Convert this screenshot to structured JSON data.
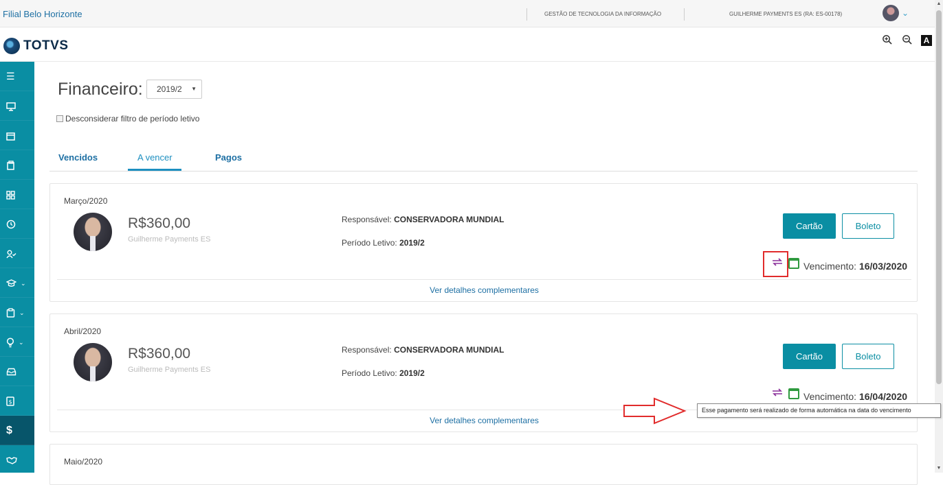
{
  "topbar": {
    "branch": "Filial Belo Horizonte",
    "unit": "GESTÃO DE TECNOLOGIA DA INFORMAÇÃO",
    "user": "GUILHERME PAYMENTS ES (RA: ES-00178)"
  },
  "brand": {
    "name": "TOTVS"
  },
  "page": {
    "title": "Financeiro:",
    "period_value": "2019/2",
    "checkbox_label": "Desconsiderar filtro de período letivo"
  },
  "tabs": [
    {
      "label": "Vencidos",
      "active": false
    },
    {
      "label": "A vencer",
      "active": true
    },
    {
      "label": "Pagos",
      "active": false
    }
  ],
  "cards": [
    {
      "month": "Março/2020",
      "amount": "R$360,00",
      "payer": "Guilherme Payments ES",
      "responsible_label": "Responsável:",
      "responsible": "CONSERVADORA MUNDIAL",
      "period_label": "Período Letivo:",
      "period": "2019/2",
      "pay_card_label": "Cartão",
      "pay_boleto_label": "Boleto",
      "due_label": "Vencimento:",
      "due_date": "16/03/2020",
      "details_link": "Ver detalhes complementares"
    },
    {
      "month": "Abril/2020",
      "amount": "R$360,00",
      "payer": "Guilherme Payments ES",
      "responsible_label": "Responsável:",
      "responsible": "CONSERVADORA MUNDIAL",
      "period_label": "Período Letivo:",
      "period": "2019/2",
      "pay_card_label": "Cartão",
      "pay_boleto_label": "Boleto",
      "due_label": "Vencimento:",
      "due_date": "16/04/2020",
      "details_link": "Ver detalhes complementares"
    },
    {
      "month": "Maio/2020"
    }
  ],
  "tooltip": {
    "text": "Esse pagamento será realizado de forma automática na data do vencimento"
  },
  "colors": {
    "accent": "#0a8ea3",
    "link": "#1d6fa3",
    "auto_icon": "#8a2d9a",
    "calendar_icon": "#2f9a3f",
    "annotation": "#e12b2b"
  }
}
